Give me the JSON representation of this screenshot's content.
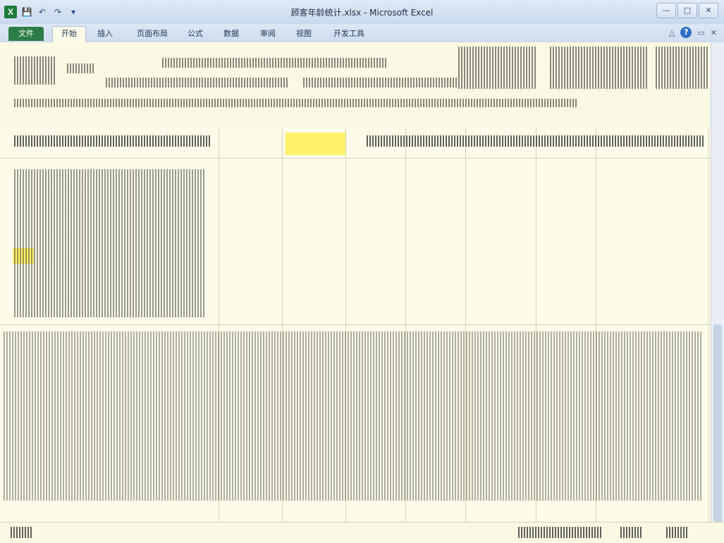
{
  "window": {
    "title": "顾客年龄统计.xlsx - Microsoft Excel",
    "app_icon": "X"
  },
  "quick_access": {
    "save_icon": "save-icon",
    "undo_icon": "undo-icon",
    "redo_icon": "redo-icon",
    "customize_icon": "customize-qat-icon"
  },
  "window_controls": {
    "minimize": "—",
    "maximize": "□",
    "close": "✕"
  },
  "ribbon_tabs": [
    "文件",
    "开始",
    "插入",
    "页面布局",
    "公式",
    "数据",
    "审阅",
    "视图",
    "开发工具"
  ],
  "ribbon_right": {
    "help": "?",
    "minimize_ribbon": "△",
    "restore_window": "▭",
    "close_workbook": "✕"
  },
  "colors": {
    "file_tab": "#2d7d46",
    "highlight_cell": "#fff36b",
    "sheet_background": "#fdfbe9"
  }
}
